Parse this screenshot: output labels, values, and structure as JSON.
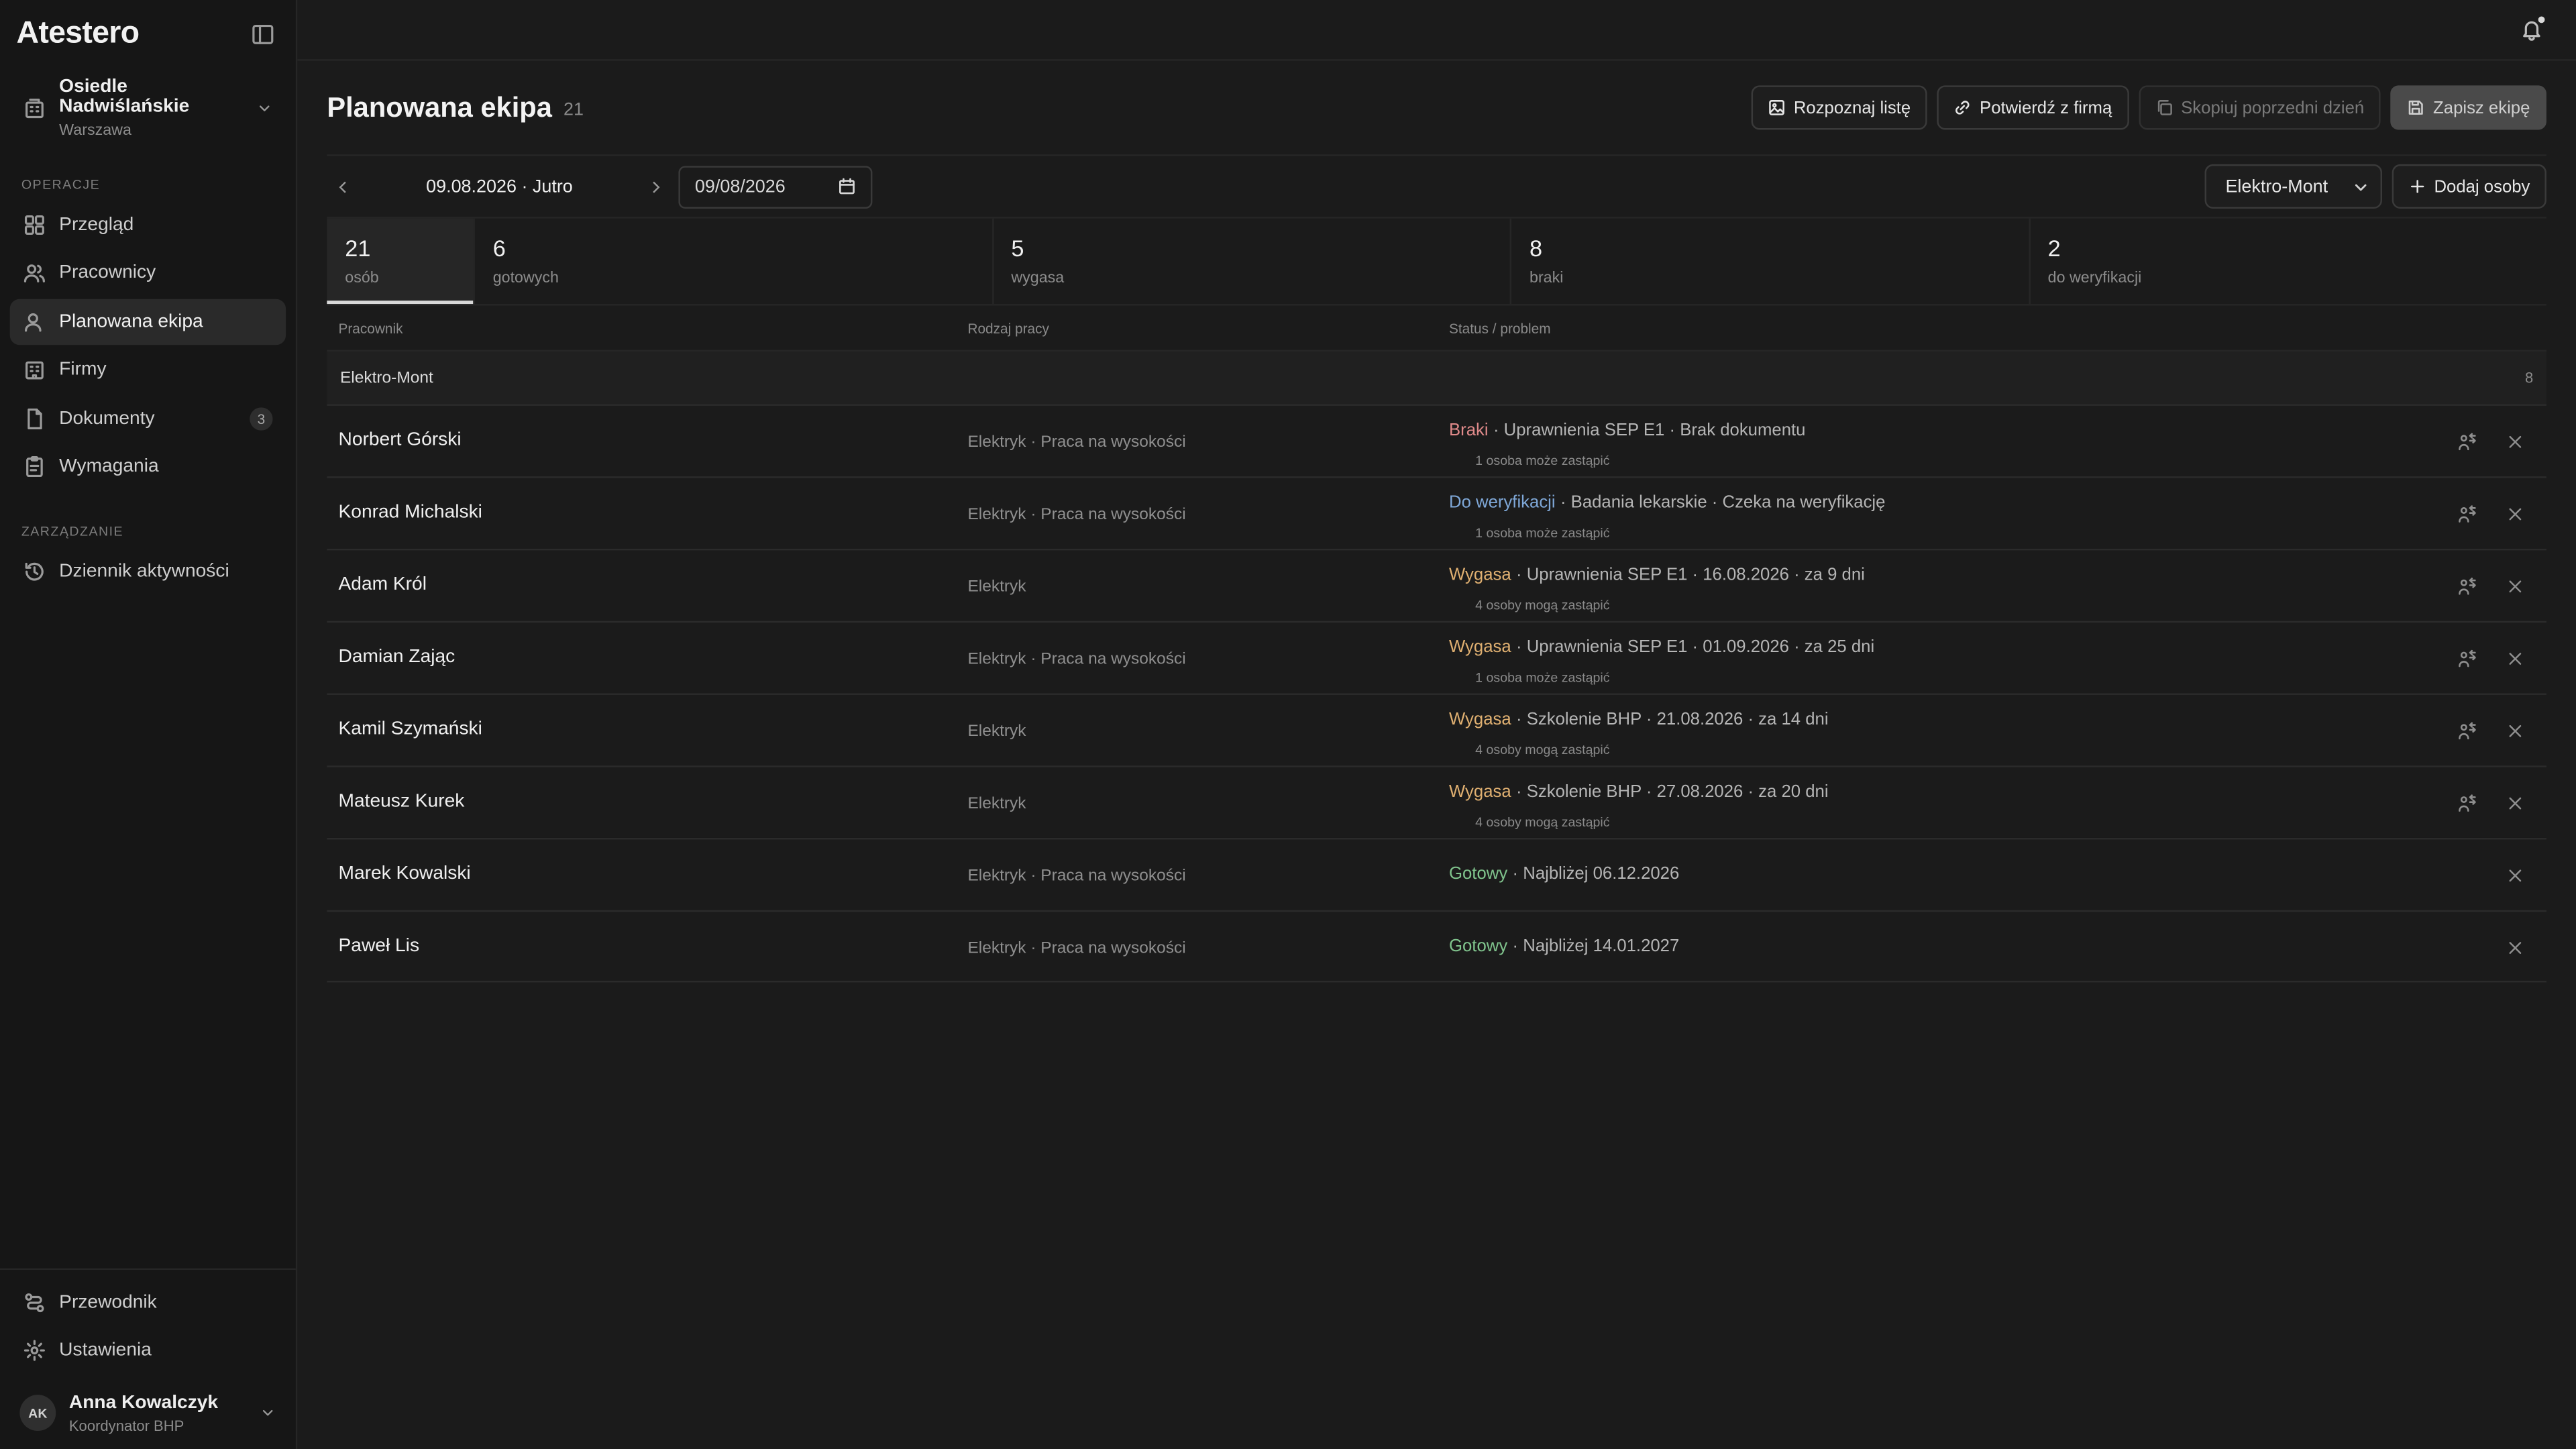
{
  "app": {
    "logo": "Atestero"
  },
  "org": {
    "name": "Osiedle Nadwiślańskie",
    "city": "Warszawa"
  },
  "nav": {
    "section1": "OPERACJE",
    "section2": "ZARZĄDZANIE",
    "items": [
      {
        "label": "Przegląd",
        "icon": "grid-icon"
      },
      {
        "label": "Pracownicy",
        "icon": "users-icon"
      },
      {
        "label": "Planowana ekipa",
        "icon": "user-icon",
        "active": true
      },
      {
        "label": "Firmy",
        "icon": "building-icon"
      },
      {
        "label": "Dokumenty",
        "icon": "document-icon",
        "badge": "3"
      },
      {
        "label": "Wymagania",
        "icon": "clipboard-icon"
      }
    ],
    "manage_items": [
      {
        "label": "Dziennik aktywności",
        "icon": "history-icon"
      }
    ],
    "bottom": [
      {
        "label": "Przewodnik",
        "icon": "route-icon"
      },
      {
        "label": "Ustawienia",
        "icon": "gear-icon"
      }
    ]
  },
  "user": {
    "initials": "AK",
    "name": "Anna Kowalczyk",
    "role": "Koordynator BHP"
  },
  "page": {
    "title": "Planowana ekipa",
    "count": "21"
  },
  "toolbar": {
    "recognize": "Rozpoznaj listę",
    "confirm": "Potwierdź z firmą",
    "copy": "Skopiuj poprzedni dzień",
    "save": "Zapisz ekipę",
    "add": "Dodaj osoby"
  },
  "date": {
    "label": "09.08.2026 · Jutro",
    "input": "09/08/2026"
  },
  "company_select": "Elektro-Mont",
  "stats": [
    {
      "num": "21",
      "label": "osób"
    },
    {
      "num": "6",
      "label": "gotowych"
    },
    {
      "num": "5",
      "label": "wygasa"
    },
    {
      "num": "8",
      "label": "braki"
    },
    {
      "num": "2",
      "label": "do weryfikacji"
    }
  ],
  "columns": {
    "worker": "Pracownik",
    "work": "Rodzaj pracy",
    "status": "Status / problem"
  },
  "group": {
    "name": "Elektro-Mont",
    "count": "8"
  },
  "rows": [
    {
      "name": "Norbert Górski",
      "work": "Elektryk · Praca na wysokości",
      "status": "Braki",
      "status_kind": "braki",
      "detail": "· Uprawnienia SEP E1 · Brak dokumentu",
      "sub": "1 osoba może zastąpić"
    },
    {
      "name": "Konrad Michalski",
      "work": "Elektryk · Praca na wysokości",
      "status": "Do weryfikacji",
      "status_kind": "weryf",
      "detail": "· Badania lekarskie · Czeka na weryfikację",
      "sub": "1 osoba może zastąpić"
    },
    {
      "name": "Adam Król",
      "work": "Elektryk",
      "status": "Wygasa",
      "status_kind": "wygasa",
      "detail": "· Uprawnienia SEP E1 · 16.08.2026 · za 9 dni",
      "sub": "4 osoby mogą zastąpić"
    },
    {
      "name": "Damian Zając",
      "work": "Elektryk · Praca na wysokości",
      "status": "Wygasa",
      "status_kind": "wygasa",
      "detail": "· Uprawnienia SEP E1 · 01.09.2026 · za 25 dni",
      "sub": "1 osoba może zastąpić"
    },
    {
      "name": "Kamil Szymański",
      "work": "Elektryk",
      "status": "Wygasa",
      "status_kind": "wygasa",
      "detail": "· Szkolenie BHP · 21.08.2026 · za 14 dni",
      "sub": "4 osoby mogą zastąpić"
    },
    {
      "name": "Mateusz Kurek",
      "work": "Elektryk",
      "status": "Wygasa",
      "status_kind": "wygasa",
      "detail": "· Szkolenie BHP · 27.08.2026 · za 20 dni",
      "sub": "4 osoby mogą zastąpić"
    },
    {
      "name": "Marek Kowalski",
      "work": "Elektryk · Praca na wysokości",
      "status": "Gotowy",
      "status_kind": "gotowy",
      "detail": "· Najbliżej 06.12.2026",
      "sub": ""
    },
    {
      "name": "Paweł Lis",
      "work": "Elektryk · Praca na wysokości",
      "status": "Gotowy",
      "status_kind": "gotowy",
      "detail": "· Najbliżej 14.01.2027",
      "sub": ""
    }
  ]
}
